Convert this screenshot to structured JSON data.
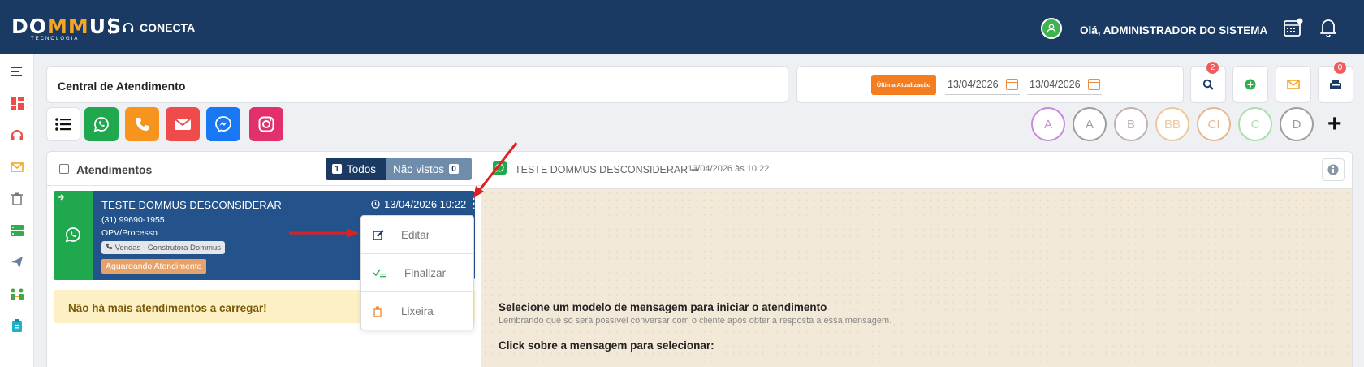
{
  "header": {
    "logo_left": "DO",
    "logo_mid": "MM",
    "logo_right": "US",
    "logo_sub": "TECNOLOGIA",
    "module": "CONECTA",
    "greeting": "Olá, ADMINISTRADOR DO SISTEMA"
  },
  "toolbar": {
    "title": "Central de Atendimento",
    "last_update_label": "Última Atualização",
    "date_from": "13/04/2026",
    "date_to": "13/04/2026",
    "search_count": "2",
    "inbox_count": "0"
  },
  "channels": [
    "list",
    "whatsapp",
    "phone",
    "email",
    "messenger",
    "instagram"
  ],
  "agents": [
    {
      "label": "A",
      "color": "#c98ad8"
    },
    {
      "label": "A",
      "color": "#9e9e9e"
    },
    {
      "label": "B",
      "color": "#c5b0b0"
    },
    {
      "label": "BB",
      "color": "#ebc99a"
    },
    {
      "label": "CI",
      "color": "#e8b790"
    },
    {
      "label": "C",
      "color": "#a9dfa9"
    },
    {
      "label": "D",
      "color": "#9e9e9e"
    }
  ],
  "list": {
    "title": "Atendimentos",
    "filter_all_count": "1",
    "filter_all": "Todos",
    "filter_unseen": "Não vistos",
    "filter_unseen_count": "0",
    "ticket": {
      "name": "TESTE DOMMUS DESCONSIDERAR",
      "phone": "(31) 99690-1955",
      "process": "OPV/Processo",
      "tag": "Vendas - Construtora Dommus",
      "status": "Aguardando Atendimento",
      "timestamp": "13/04/2026 10:22"
    },
    "empty_msg": "Não há mais atendimentos a carregar!"
  },
  "menu": {
    "edit": "Editar",
    "finish": "Finalizar",
    "trash": "Lixeira"
  },
  "chat": {
    "contact": "TESTE DOMMUS DESCONSIDERAR",
    "date": "13/04/2026 às 10:22",
    "prompt_title": "Selecione um modelo de mensagem para iniciar o atendimento",
    "prompt_note": "Lembrando que só será possível conversar com o cliente após obter a resposta a essa mensagem.",
    "prompt_action": "Click sobre a mensagem para selecionar:"
  },
  "colors": {
    "navy": "#1b3a63",
    "whatsapp": "#20a84e",
    "phone": "#f7941d",
    "email": "#ef4b4b",
    "messenger": "#1877f2",
    "instagram": "#e1306c"
  }
}
